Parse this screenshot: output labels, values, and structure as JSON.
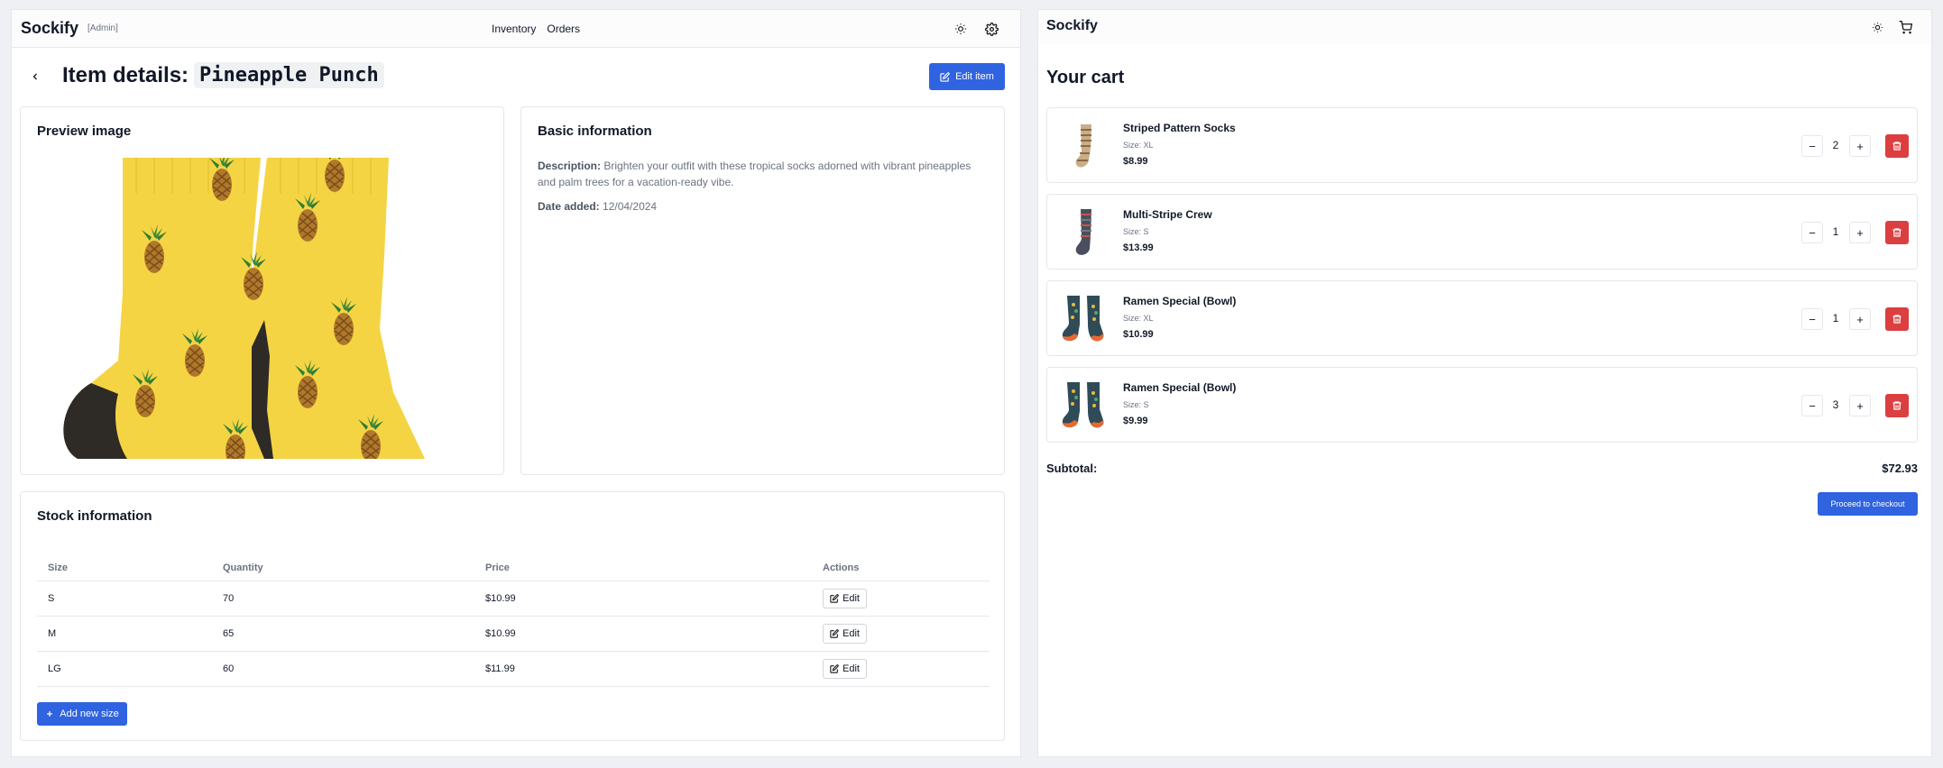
{
  "admin": {
    "brand": "Sockify",
    "brand_tag": "[Admin]",
    "nav": [
      "Inventory",
      "Orders"
    ],
    "title_prefix": "Item details:",
    "item_name": "Pineapple Punch",
    "edit_item_label": "Edit item",
    "preview_title": "Preview image",
    "basic_title": "Basic information",
    "description_label": "Description:",
    "description": "Brighten your outfit with these tropical socks adorned with vibrant pineapples and palm trees for a vacation-ready vibe.",
    "date_label": "Date added:",
    "date_value": "12/04/2024",
    "stock_title": "Stock information",
    "stock_headers": [
      "Size",
      "Quantity",
      "Price",
      "Actions"
    ],
    "stock_rows": [
      {
        "size": "S",
        "quantity": "70",
        "price": "$10.99",
        "action": "Edit"
      },
      {
        "size": "M",
        "quantity": "65",
        "price": "$10.99",
        "action": "Edit"
      },
      {
        "size": "LG",
        "quantity": "60",
        "price": "$11.99",
        "action": "Edit"
      }
    ],
    "add_size_label": "Add new size"
  },
  "store": {
    "brand": "Sockify",
    "cart_heading": "Your cart",
    "items": [
      {
        "name": "Striped Pattern Socks",
        "size": "Size: XL",
        "price": "$8.99",
        "qty": "2"
      },
      {
        "name": "Multi-Stripe Crew",
        "size": "Size: S",
        "price": "$13.99",
        "qty": "1"
      },
      {
        "name": "Ramen Special (Bowl)",
        "size": "Size: XL",
        "price": "$10.99",
        "qty": "1"
      },
      {
        "name": "Ramen Special (Bowl)",
        "size": "Size: S",
        "price": "$9.99",
        "qty": "3"
      }
    ],
    "subtotal_label": "Subtotal:",
    "subtotal_value": "$72.93",
    "checkout_label": "Proceed to checkout"
  },
  "colors": {
    "primary": "#2f63e0",
    "danger": "#dc3f3f",
    "sock_yellow": "#f5d444",
    "sock_heel": "#2e2a26"
  },
  "icons": [
    "sun-icon",
    "gear-icon",
    "chevron-left-icon",
    "edit-icon",
    "plus-icon",
    "cart-icon",
    "trash-icon",
    "minus-icon"
  ]
}
